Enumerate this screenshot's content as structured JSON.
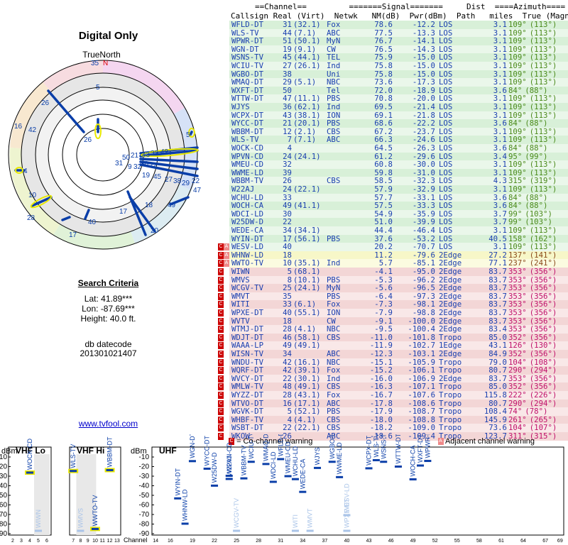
{
  "title": "Digital Only",
  "true_north": "TrueNorth",
  "north_marker": "N",
  "search": {
    "heading": "Search Criteria",
    "lat": "Lat: 41.89***",
    "lon": "Lon: -87.69***",
    "height": "Height: 40.0 ft.",
    "db_label": "db datecode",
    "db_value": "201301021407"
  },
  "site_link": "www.tvfool.com",
  "table_headers": {
    "group_line": "==Channel==         =======Signal=======     Dist  ====Azimuth====",
    "cols_line": "Callsign Real (Virt)  Netwk   NM(dB)  Pwr(dBm)  Path   miles  True (Magn)"
  },
  "radar_labels": [
    "35",
    "N",
    "5",
    "26",
    "16",
    "42",
    "4",
    "10",
    "28",
    "17",
    "40",
    "20",
    "18",
    "49",
    "47",
    "22",
    "5",
    "26",
    "50",
    "21",
    "31",
    "43",
    "33",
    "49",
    "19",
    "45",
    "27",
    "38",
    "29",
    "32",
    "30",
    "22",
    "17",
    "9"
  ],
  "rows": [
    {
      "cs": "WFLD-DT",
      "rl": "31",
      "vt": "(32.1)",
      "nw": "Fox",
      "nm": "78.6",
      "pw": "-12.2",
      "pa": "LOS",
      "mi": "3.1",
      "az": "109°",
      "mg": "(113°)",
      "zone": "g",
      "w": ""
    },
    {
      "cs": "WLS-TV",
      "rl": "44",
      "vt": "(7.1)",
      "nw": "ABC",
      "nm": "77.5",
      "pw": "-13.3",
      "pa": "LOS",
      "mi": "3.1",
      "az": "109°",
      "mg": "(113°)",
      "zone": "g",
      "w": ""
    },
    {
      "cs": "WPWR-DT",
      "rl": "51",
      "vt": "(50.1)",
      "nw": "MyN",
      "nm": "76.7",
      "pw": "-14.1",
      "pa": "LOS",
      "mi": "3.1",
      "az": "109°",
      "mg": "(113°)",
      "zone": "g",
      "w": ""
    },
    {
      "cs": "WGN-DT",
      "rl": "19",
      "vt": "(9.1)",
      "nw": "CW",
      "nm": "76.5",
      "pw": "-14.3",
      "pa": "LOS",
      "mi": "3.1",
      "az": "109°",
      "mg": "(113°)",
      "zone": "g",
      "w": ""
    },
    {
      "cs": "WSNS-TV",
      "rl": "45",
      "vt": "(44.1)",
      "nw": "TEL",
      "nm": "75.9",
      "pw": "-15.0",
      "pa": "LOS",
      "mi": "3.1",
      "az": "109°",
      "mg": "(113°)",
      "zone": "g",
      "w": ""
    },
    {
      "cs": "WCIU-TV",
      "rl": "27",
      "vt": "(26.1)",
      "nw": "Ind",
      "nm": "75.8",
      "pw": "-15.0",
      "pa": "LOS",
      "mi": "3.1",
      "az": "109°",
      "mg": "(113°)",
      "zone": "g",
      "w": ""
    },
    {
      "cs": "WGBO-DT",
      "rl": "38",
      "vt": "",
      "nw": "Uni",
      "nm": "75.8",
      "pw": "-15.0",
      "pa": "LOS",
      "mi": "3.1",
      "az": "109°",
      "mg": "(113°)",
      "zone": "g",
      "w": ""
    },
    {
      "cs": "WMAQ-DT",
      "rl": "29",
      "vt": "(5.1)",
      "nw": "NBC",
      "nm": "73.6",
      "pw": "-17.3",
      "pa": "LOS",
      "mi": "3.1",
      "az": "109°",
      "mg": "(113°)",
      "zone": "g",
      "w": ""
    },
    {
      "cs": "WXFT-DT",
      "rl": "50",
      "vt": "",
      "nw": "Tel",
      "nm": "72.0",
      "pw": "-18.9",
      "pa": "LOS",
      "mi": "3.6",
      "az": "84°",
      "mg": "(88°)",
      "zone": "g",
      "w": ""
    },
    {
      "cs": "WTTW-DT",
      "rl": "47",
      "vt": "(11.1)",
      "nw": "PBS",
      "nm": "70.8",
      "pw": "-20.0",
      "pa": "LOS",
      "mi": "3.1",
      "az": "109°",
      "mg": "(113°)",
      "zone": "g",
      "w": ""
    },
    {
      "cs": "WJYS",
      "rl": "36",
      "vt": "(62.1)",
      "nw": "Ind",
      "nm": "69.5",
      "pw": "-21.4",
      "pa": "LOS",
      "mi": "3.1",
      "az": "109°",
      "mg": "(113°)",
      "zone": "g",
      "w": ""
    },
    {
      "cs": "WCPX-DT",
      "rl": "43",
      "vt": "(38.1)",
      "nw": "ION",
      "nm": "69.1",
      "pw": "-21.8",
      "pa": "LOS",
      "mi": "3.1",
      "az": "109°",
      "mg": "(113°)",
      "zone": "g",
      "w": ""
    },
    {
      "cs": "WYCC-DT",
      "rl": "21",
      "vt": "(20.1)",
      "nw": "PBS",
      "nm": "68.6",
      "pw": "-22.2",
      "pa": "LOS",
      "mi": "3.6",
      "az": "84°",
      "mg": "(88°)",
      "zone": "g",
      "w": ""
    },
    {
      "cs": "WBBM-DT",
      "rl": "12",
      "vt": "(2.1)",
      "nw": "CBS",
      "nm": "67.2",
      "pw": "-23.7",
      "pa": "LOS",
      "mi": "3.1",
      "az": "109°",
      "mg": "(113°)",
      "zone": "g",
      "w": ""
    },
    {
      "cs": "WLS-TV",
      "rl": "7",
      "vt": "(7.1)",
      "nw": "ABC",
      "nm": "66.3",
      "pw": "-24.6",
      "pa": "LOS",
      "mi": "3.1",
      "az": "109°",
      "mg": "(113°)",
      "zone": "g",
      "w": ""
    },
    {
      "cs": "WOCK-CD",
      "rl": "4",
      "vt": "",
      "nw": "",
      "nm": "64.5",
      "pw": "-26.3",
      "pa": "LOS",
      "mi": "3.6",
      "az": "84°",
      "mg": "(88°)",
      "zone": "g",
      "w": ""
    },
    {
      "cs": "WPVN-CD",
      "rl": "24",
      "vt": "(24.1)",
      "nw": "",
      "nm": "61.2",
      "pw": "-29.6",
      "pa": "LOS",
      "mi": "3.4",
      "az": "95°",
      "mg": "(99°)",
      "zone": "g",
      "w": ""
    },
    {
      "cs": "WMEU-CD",
      "rl": "32",
      "vt": "",
      "nw": "",
      "nm": "60.8",
      "pw": "-30.0",
      "pa": "LOS",
      "mi": "3.1",
      "az": "109°",
      "mg": "(113°)",
      "zone": "g",
      "w": ""
    },
    {
      "cs": "WWME-LD",
      "rl": "39",
      "vt": "",
      "nw": "",
      "nm": "59.8",
      "pw": "-31.0",
      "pa": "LOS",
      "mi": "3.1",
      "az": "109°",
      "mg": "(113°)",
      "zone": "g",
      "w": ""
    },
    {
      "cs": "WBBM-TV",
      "rl": "26",
      "vt": "",
      "nw": "CBS",
      "nm": "58.5",
      "pw": "-32.3",
      "pa": "LOS",
      "mi": "4.3",
      "az": "315°",
      "mg": "(319°)",
      "zone": "g",
      "w": ""
    },
    {
      "cs": "W22AJ",
      "rl": "24",
      "vt": "(22.1)",
      "nw": "",
      "nm": "57.9",
      "pw": "-32.9",
      "pa": "LOS",
      "mi": "3.1",
      "az": "109°",
      "mg": "(113°)",
      "zone": "g",
      "w": ""
    },
    {
      "cs": "WCHU-LD",
      "rl": "33",
      "vt": "",
      "nw": "",
      "nm": "57.7",
      "pw": "-33.1",
      "pa": "LOS",
      "mi": "3.6",
      "az": "84°",
      "mg": "(88°)",
      "zone": "g",
      "w": ""
    },
    {
      "cs": "WOCH-CA",
      "rl": "49",
      "vt": "(41.1)",
      "nw": "",
      "nm": "57.5",
      "pw": "-33.3",
      "pa": "LOS",
      "mi": "3.6",
      "az": "84°",
      "mg": "(88°)",
      "zone": "g",
      "w": ""
    },
    {
      "cs": "WDCI-LD",
      "rl": "30",
      "vt": "",
      "nw": "",
      "nm": "54.9",
      "pw": "-35.9",
      "pa": "LOS",
      "mi": "3.7",
      "az": "99°",
      "mg": "(103°)",
      "zone": "g",
      "w": ""
    },
    {
      "cs": "W25DW-D",
      "rl": "22",
      "vt": "",
      "nw": "",
      "nm": "51.0",
      "pw": "-39.9",
      "pa": "LOS",
      "mi": "3.7",
      "az": "99°",
      "mg": "(103°)",
      "zone": "g",
      "w": ""
    },
    {
      "cs": "WEDE-CA",
      "rl": "34",
      "vt": "(34.1)",
      "nw": "",
      "nm": "44.4",
      "pw": "-46.4",
      "pa": "LOS",
      "mi": "3.1",
      "az": "109°",
      "mg": "(113°)",
      "zone": "g",
      "w": ""
    },
    {
      "cs": "WYIN-DT",
      "rl": "17",
      "vt": "(56.1)",
      "nw": "PBS",
      "nm": "37.6",
      "pw": "-53.2",
      "pa": "LOS",
      "mi": "40.5",
      "az": "158°",
      "mg": "(162°)",
      "zone": "g",
      "w": ""
    },
    {
      "cs": "WESV-LD",
      "rl": "40",
      "vt": "",
      "nw": "",
      "nm": "20.2",
      "pw": "-70.7",
      "pa": "LOS",
      "mi": "3.1",
      "az": "109°",
      "mg": "(113°)",
      "zone": "g",
      "w": "CA"
    },
    {
      "cs": "WHNW-LD",
      "rl": "18",
      "vt": "",
      "nw": "",
      "nm": "11.2",
      "pw": "-79.6",
      "pa": "2Edge",
      "mi": "27.2",
      "az": "137°",
      "mg": "(141°)",
      "zone": "y",
      "w": "CA"
    },
    {
      "cs": "WWTO-TV",
      "rl": "10",
      "vt": "(35.1)",
      "nw": "Ind",
      "nm": "5.7",
      "pw": "-85.1",
      "pa": "2Edge",
      "mi": "77.1",
      "az": "237°",
      "mg": "(241°)",
      "zone": "y",
      "w": "CA"
    },
    {
      "cs": "WIWN",
      "rl": "5",
      "vt": "(68.1)",
      "nw": "",
      "nm": "-4.1",
      "pw": "-95.0",
      "pa": "2Edge",
      "mi": "83.7",
      "az": "353°",
      "mg": "(356°)",
      "zone": "r",
      "w": "C"
    },
    {
      "cs": "WMVS",
      "rl": "8",
      "vt": "(10.1)",
      "nw": "PBS",
      "nm": "-5.3",
      "pw": "-96.2",
      "pa": "2Edge",
      "mi": "83.7",
      "az": "353°",
      "mg": "(356°)",
      "zone": "r",
      "w": "C"
    },
    {
      "cs": "WCGV-TV",
      "rl": "25",
      "vt": "(24.1)",
      "nw": "MyN",
      "nm": "-5.6",
      "pw": "-96.5",
      "pa": "2Edge",
      "mi": "83.7",
      "az": "353°",
      "mg": "(356°)",
      "zone": "r",
      "w": "C"
    },
    {
      "cs": "WMVT",
      "rl": "35",
      "vt": "",
      "nw": "PBS",
      "nm": "-6.4",
      "pw": "-97.3",
      "pa": "2Edge",
      "mi": "83.7",
      "az": "353°",
      "mg": "(356°)",
      "zone": "r",
      "w": "C"
    },
    {
      "cs": "WITI",
      "rl": "33",
      "vt": "(6.1)",
      "nw": "Fox",
      "nm": "-7.3",
      "pw": "-98.1",
      "pa": "2Edge",
      "mi": "83.7",
      "az": "353°",
      "mg": "(356°)",
      "zone": "r",
      "w": "C"
    },
    {
      "cs": "WPXE-DT",
      "rl": "40",
      "vt": "(55.1)",
      "nw": "ION",
      "nm": "-7.9",
      "pw": "-98.8",
      "pa": "2Edge",
      "mi": "83.7",
      "az": "353°",
      "mg": "(356°)",
      "zone": "r",
      "w": "C"
    },
    {
      "cs": "WVTV",
      "rl": "18",
      "vt": "",
      "nw": "CW",
      "nm": "-9.1",
      "pw": "-100.0",
      "pa": "2Edge",
      "mi": "83.7",
      "az": "353°",
      "mg": "(356°)",
      "zone": "r",
      "w": "C"
    },
    {
      "cs": "WTMJ-DT",
      "rl": "28",
      "vt": "(4.1)",
      "nw": "NBC",
      "nm": "-9.5",
      "pw": "-100.4",
      "pa": "2Edge",
      "mi": "83.4",
      "az": "353°",
      "mg": "(356°)",
      "zone": "r",
      "w": "C"
    },
    {
      "cs": "WDJT-DT",
      "rl": "46",
      "vt": "(58.1)",
      "nw": "CBS",
      "nm": "-11.0",
      "pw": "-101.8",
      "pa": "Tropo",
      "mi": "85.0",
      "az": "352°",
      "mg": "(356°)",
      "zone": "r",
      "w": "C"
    },
    {
      "cs": "WAAA-LP",
      "rl": "49",
      "vt": "(49.1)",
      "nw": "",
      "nm": "-11.9",
      "pw": "-102.7",
      "pa": "1Edge",
      "mi": "43.1",
      "az": "126°",
      "mg": "(130°)",
      "zone": "r",
      "w": "C"
    },
    {
      "cs": "WISN-TV",
      "rl": "34",
      "vt": "",
      "nw": "ABC",
      "nm": "-12.3",
      "pw": "-103.1",
      "pa": "2Edge",
      "mi": "84.9",
      "az": "352°",
      "mg": "(356°)",
      "zone": "r",
      "w": "C"
    },
    {
      "cs": "WNDU-TV",
      "rl": "42",
      "vt": "(16.1)",
      "nw": "NBC",
      "nm": "-15.1",
      "pw": "-105.9",
      "pa": "Tropo",
      "mi": "79.0",
      "az": "104°",
      "mg": "(108°)",
      "zone": "r",
      "w": "C"
    },
    {
      "cs": "WQRF-DT",
      "rl": "42",
      "vt": "(39.1)",
      "nw": "Fox",
      "nm": "-15.2",
      "pw": "-106.1",
      "pa": "Tropo",
      "mi": "80.7",
      "az": "290°",
      "mg": "(294°)",
      "zone": "r",
      "w": "C"
    },
    {
      "cs": "WVCY-DT",
      "rl": "22",
      "vt": "(30.1)",
      "nw": "Ind",
      "nm": "-16.0",
      "pw": "-106.9",
      "pa": "2Edge",
      "mi": "83.7",
      "az": "353°",
      "mg": "(356°)",
      "zone": "r",
      "w": "C"
    },
    {
      "cs": "WMLW-TV",
      "rl": "48",
      "vt": "(49.1)",
      "nw": "CBS",
      "nm": "-16.3",
      "pw": "-107.1",
      "pa": "Tropo",
      "mi": "85.0",
      "az": "352°",
      "mg": "(356°)",
      "zone": "r",
      "w": "C"
    },
    {
      "cs": "WYZZ-DT",
      "rl": "28",
      "vt": "(43.1)",
      "nw": "Fox",
      "nm": "-16.7",
      "pw": "-107.6",
      "pa": "Tropo",
      "mi": "115.8",
      "az": "222°",
      "mg": "(226°)",
      "zone": "r",
      "w": "C"
    },
    {
      "cs": "WTVO-DT",
      "rl": "16",
      "vt": "(17.1)",
      "nw": "ABC",
      "nm": "-17.8",
      "pw": "-108.6",
      "pa": "Tropo",
      "mi": "80.7",
      "az": "290°",
      "mg": "(294°)",
      "zone": "r",
      "w": "C"
    },
    {
      "cs": "WGVK-DT",
      "rl": "5",
      "vt": "(52.1)",
      "nw": "PBS",
      "nm": "-17.9",
      "pw": "-108.7",
      "pa": "Tropo",
      "mi": "108.4",
      "az": "74°",
      "mg": "(78°)",
      "zone": "r",
      "w": "C"
    },
    {
      "cs": "WHBF-TV",
      "rl": "4",
      "vt": "(4.1)",
      "nw": "CBS",
      "nm": "-18.0",
      "pw": "-108.8",
      "pa": "Tropo",
      "mi": "145.9",
      "az": "261°",
      "mg": "(265°)",
      "zone": "r",
      "w": "C"
    },
    {
      "cs": "WSBT-DT",
      "rl": "22",
      "vt": "(22.1)",
      "nw": "CBS",
      "nm": "-18.2",
      "pw": "-109.0",
      "pa": "Tropo",
      "mi": "73.6",
      "az": "104°",
      "mg": "(107°)",
      "zone": "r",
      "w": "C"
    },
    {
      "cs": "WKOW",
      "rl": "26",
      "vt": "",
      "nw": "ABC",
      "nm": "-18.6",
      "pw": "-109.4",
      "pa": "Tropo",
      "mi": "123.7",
      "az": "311°",
      "mg": "(315°)",
      "zone": "r",
      "w": "C"
    }
  ],
  "legend": {
    "co_mark": "C",
    "co_label": "= Co-channel warning",
    "adj_mark": "A",
    "adj_label": "Adjacent channel warning"
  },
  "chart_data": [
    {
      "type": "scatter",
      "title": "VHF Lo",
      "ylabel": "dBm",
      "xlabel": "Channel",
      "ylim": [
        -90,
        -10
      ],
      "x_ticks": [
        2,
        3,
        4,
        5,
        6
      ],
      "y_ticks": [
        -10,
        -20,
        -30,
        -40,
        -50,
        -60,
        -70,
        -80,
        -90
      ],
      "points": [
        {
          "ch": 4,
          "dbm": -26.3,
          "label": "WOCK-CD",
          "strong": true
        },
        {
          "ch": 5,
          "dbm": -95.0,
          "label": "WIWN",
          "strong": false
        }
      ]
    },
    {
      "type": "scatter",
      "title": "VHF Hi",
      "xlabel": "Channel",
      "ylim": [
        -90,
        -10
      ],
      "x_ticks": [
        7,
        8,
        9,
        10,
        11,
        12,
        13
      ],
      "points": [
        {
          "ch": 7,
          "dbm": -24.6,
          "label": "WLS-TV",
          "strong": true
        },
        {
          "ch": 8,
          "dbm": -96.2,
          "label": "WMVS",
          "strong": false
        },
        {
          "ch": 10,
          "dbm": -85.1,
          "label": "WWTO-TV",
          "strong": true
        },
        {
          "ch": 12,
          "dbm": -23.7,
          "label": "WBBM-DT",
          "strong": true
        }
      ]
    },
    {
      "type": "scatter",
      "title": "UHF",
      "ylabel": "dBm",
      "xlabel": "Channel",
      "ylim": [
        -90,
        -10
      ],
      "x_ticks": [
        14,
        16,
        19,
        22,
        25,
        28,
        31,
        34,
        37,
        40,
        43,
        46,
        49,
        52,
        55,
        58,
        61,
        64,
        67,
        69
      ],
      "y_ticks": [
        -10,
        -20,
        -30,
        -40,
        -50,
        -60,
        -70,
        -80,
        -90
      ],
      "points": [
        {
          "ch": 17,
          "dbm": -53.2,
          "label": "WYIN-DT",
          "strong": true
        },
        {
          "ch": 18,
          "dbm": -79.6,
          "label": "WHNW-LD",
          "strong": true
        },
        {
          "ch": 19,
          "dbm": -14.3,
          "label": "WGN-DT",
          "strong": true
        },
        {
          "ch": 21,
          "dbm": -22.2,
          "label": "WYCC-DT",
          "strong": true
        },
        {
          "ch": 22,
          "dbm": -39.9,
          "label": "W25DW-D",
          "strong": true
        },
        {
          "ch": 24,
          "dbm": -29.6,
          "label": "WPVN-CD",
          "strong": true
        },
        {
          "ch": 24,
          "dbm": -32.9,
          "label": "W22AJ",
          "strong": true
        },
        {
          "ch": 25,
          "dbm": -96.5,
          "label": "WCGV-TV",
          "strong": false
        },
        {
          "ch": 26,
          "dbm": -32.3,
          "label": "WBBM-TV",
          "strong": true
        },
        {
          "ch": 27,
          "dbm": -15.0,
          "label": "WCIU-TV",
          "strong": true
        },
        {
          "ch": 29,
          "dbm": -17.3,
          "label": "WMAQ-DT",
          "strong": true
        },
        {
          "ch": 30,
          "dbm": -35.9,
          "label": "WDCI-LD",
          "strong": true
        },
        {
          "ch": 31,
          "dbm": -12.2,
          "label": "WFLD-DT",
          "strong": true
        },
        {
          "ch": 32,
          "dbm": -30.0,
          "label": "WMEU-CD",
          "strong": true
        },
        {
          "ch": 33,
          "dbm": -33.1,
          "label": "WCHU-LD",
          "strong": true
        },
        {
          "ch": 33,
          "dbm": -98.1,
          "label": "WITI",
          "strong": false
        },
        {
          "ch": 34,
          "dbm": -46.4,
          "label": "WEDE-CA",
          "strong": true
        },
        {
          "ch": 35,
          "dbm": -97.3,
          "label": "WMVT",
          "strong": false
        },
        {
          "ch": 36,
          "dbm": -21.4,
          "label": "WJYS",
          "strong": true
        },
        {
          "ch": 38,
          "dbm": -15.0,
          "label": "WGBO-DT",
          "strong": true
        },
        {
          "ch": 39,
          "dbm": -31.0,
          "label": "WWME-LD",
          "strong": true
        },
        {
          "ch": 40,
          "dbm": -70.7,
          "label": "WESV-LD",
          "strong": false
        },
        {
          "ch": 40,
          "dbm": -98.8,
          "label": "WPXE-DT",
          "strong": false
        },
        {
          "ch": 43,
          "dbm": -21.8,
          "label": "WCPX-DT",
          "strong": true
        },
        {
          "ch": 44,
          "dbm": -13.3,
          "label": "WLS-TV",
          "strong": true
        },
        {
          "ch": 45,
          "dbm": -15.0,
          "label": "WSNS-TV",
          "strong": true
        },
        {
          "ch": 47,
          "dbm": -20.0,
          "label": "WTTW-DT",
          "strong": true
        },
        {
          "ch": 49,
          "dbm": -33.3,
          "label": "WOCH-CA",
          "strong": true
        },
        {
          "ch": 50,
          "dbm": -18.9,
          "label": "WXFT-DT",
          "strong": true
        },
        {
          "ch": 51,
          "dbm": -14.1,
          "label": "WPWR-DT",
          "strong": true
        }
      ]
    }
  ]
}
